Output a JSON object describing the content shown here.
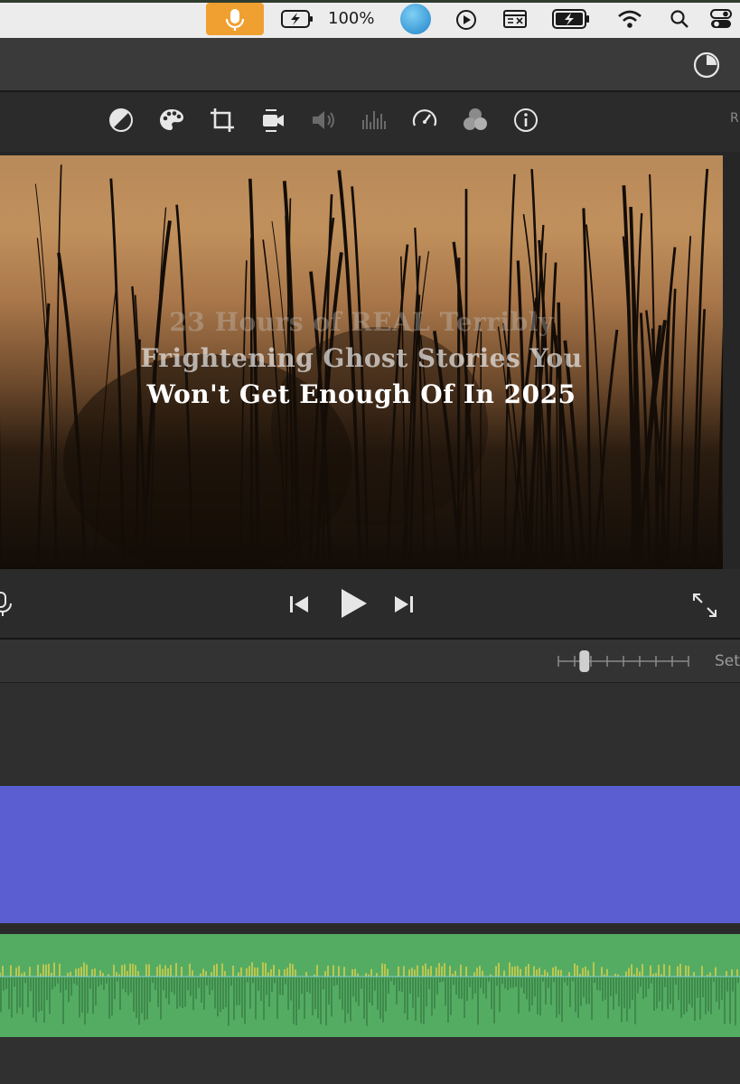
{
  "menubar": {
    "battery_percent": "100%",
    "icons": [
      "microphone-icon",
      "battery-charging-icon",
      "siri-icon",
      "play-circle-icon",
      "keyboard-icon",
      "battery-icon",
      "wifi-icon",
      "search-icon",
      "control-center-icon"
    ]
  },
  "top_toolbar": {
    "icons": [
      "share-pie-icon"
    ]
  },
  "viewer_toolbar": {
    "icons": [
      "color-balance-icon",
      "color-palette-icon",
      "crop-icon",
      "stabilization-icon",
      "volume-icon",
      "equalizer-icon",
      "speed-icon",
      "filter-icon",
      "info-icon"
    ],
    "right_label": "R"
  },
  "viewer": {
    "title_lines": [
      "23 Hours of  REAL Terribly",
      "Frightening Ghost Stories You",
      "Won't Get Enough Of In 2025"
    ]
  },
  "transport": {
    "icons": [
      "microphone-icon",
      "skip-back-icon",
      "play-icon",
      "skip-forward-icon",
      "fullscreen-icon"
    ]
  },
  "zoom": {
    "level": 0.2,
    "settings_label": "Set"
  },
  "colors": {
    "video_track": "#5a5ed0",
    "audio_track": "#54ac62",
    "mic_active": "#f0a030"
  }
}
